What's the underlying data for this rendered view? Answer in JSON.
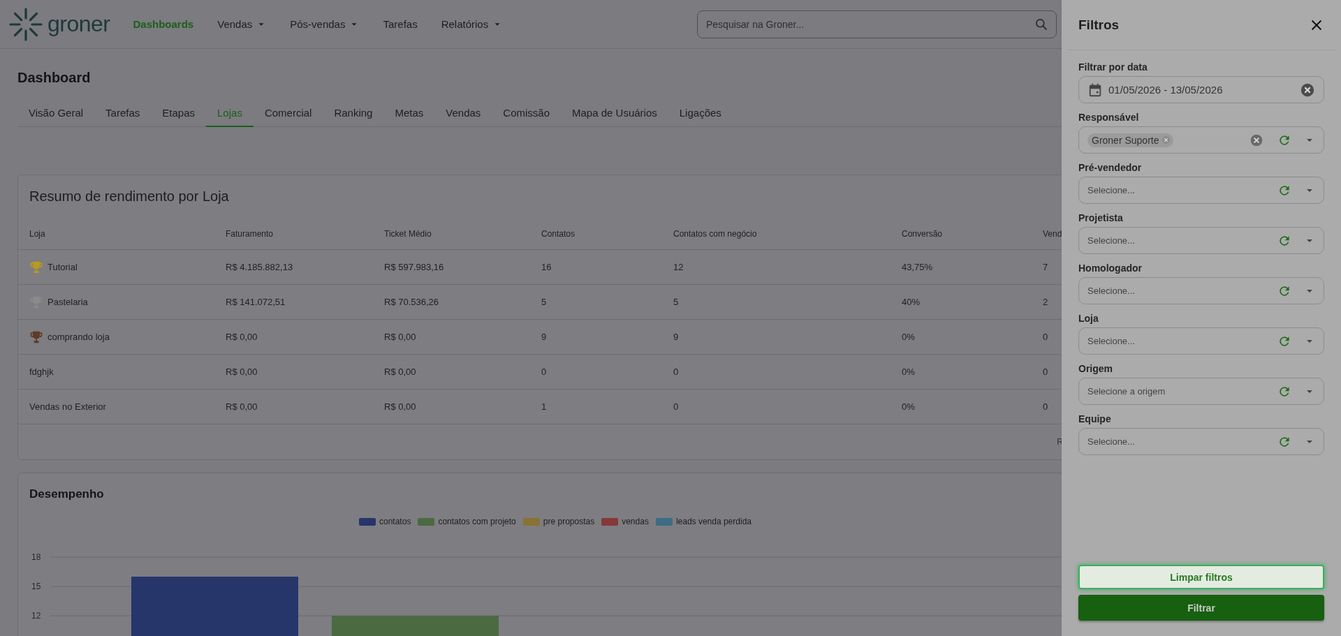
{
  "header": {
    "logo": "groner",
    "nav": [
      {
        "label": "Dashboards",
        "selected": true,
        "dropdown": false
      },
      {
        "label": "Vendas",
        "selected": false,
        "dropdown": true
      },
      {
        "label": "Pós-vendas",
        "selected": false,
        "dropdown": true
      },
      {
        "label": "Tarefas",
        "selected": false,
        "dropdown": false
      },
      {
        "label": "Relatórios",
        "selected": false,
        "dropdown": true
      }
    ],
    "search": {
      "placeholder": "Pesquisar na Groner..."
    }
  },
  "page_title": "Dashboard",
  "tabs": [
    {
      "label": "Visão Geral",
      "selected": false
    },
    {
      "label": "Tarefas",
      "selected": false
    },
    {
      "label": "Etapas",
      "selected": false
    },
    {
      "label": "Lojas",
      "selected": true
    },
    {
      "label": "Comercial",
      "selected": false
    },
    {
      "label": "Ranking",
      "selected": false
    },
    {
      "label": "Metas",
      "selected": false
    },
    {
      "label": "Vendas",
      "selected": false
    },
    {
      "label": "Comissão",
      "selected": false
    },
    {
      "label": "Mapa de Usuários",
      "selected": false
    },
    {
      "label": "Ligações",
      "selected": false
    }
  ],
  "table": {
    "title": "Resumo de rendimento por Loja",
    "columns": [
      "Loja",
      "Faturamento",
      "Ticket Médio",
      "Contatos",
      "Contatos com negócio",
      "Conversão",
      "Vend"
    ],
    "rows": [
      {
        "color": "#b89a1e",
        "cells": [
          "Tutorial",
          "R$ 4.185.882,13",
          "R$ 597.983,16",
          "16",
          "12",
          "43,75%",
          "7"
        ]
      },
      {
        "color": "#8a8a8a",
        "cells": [
          "Pastelaria",
          "R$ 141.072,51",
          "R$ 70.536,26",
          "5",
          "5",
          "40%",
          "2"
        ]
      },
      {
        "color": "#5e3a28",
        "cells": [
          "comprando loja",
          "R$ 0,00",
          "R$ 0,00",
          "9",
          "9",
          "0%",
          "0"
        ]
      },
      {
        "cells": [
          "fdghjk",
          "R$ 0,00",
          "R$ 0,00",
          "0",
          "0",
          "0%",
          "0"
        ]
      },
      {
        "cells": [
          "Vendas no Exterior",
          "R$ 0,00",
          "R$ 0,00",
          "1",
          "0",
          "0%",
          "0"
        ]
      }
    ],
    "footer_text": "R"
  },
  "performance": {
    "title": "Desempenho",
    "chart_data": {
      "type": "bar",
      "ylim": [
        9.5,
        18
      ],
      "grid": true,
      "yticks": [
        12,
        15,
        18
      ],
      "series": [
        {
          "name": "contatos",
          "color": "#27366a",
          "values": [
            16
          ]
        },
        {
          "name": "contatos com projeto",
          "color": "#4b6a41",
          "values": [
            12
          ]
        },
        {
          "name": "pre propostas",
          "color": "#8a7234",
          "values": [
            null
          ]
        },
        {
          "name": "vendas",
          "color": "#873838",
          "values": [
            null
          ]
        },
        {
          "name": "leads venda perdida",
          "color": "#3e6c83",
          "values": [
            null
          ]
        }
      ]
    }
  },
  "filters": {
    "title": "Filtros",
    "fields": [
      {
        "kind": "date",
        "label": "Filtrar por data",
        "value": "01/05/2026 - 13/05/2026"
      },
      {
        "kind": "multi",
        "label": "Responsável",
        "chips": [
          "Groner Suporte"
        ]
      },
      {
        "kind": "select",
        "label": "Pré-vendedor",
        "placeholder": "Selecione..."
      },
      {
        "kind": "select",
        "label": "Projetista",
        "placeholder": "Selecione..."
      },
      {
        "kind": "select",
        "label": "Homologador",
        "placeholder": "Selecione..."
      },
      {
        "kind": "select",
        "label": "Loja",
        "placeholder": "Selecione..."
      },
      {
        "kind": "select",
        "label": "Origem",
        "placeholder": "Selecione a origem"
      },
      {
        "kind": "select",
        "label": "Equipe",
        "placeholder": "Selecione..."
      }
    ],
    "buttons": [
      {
        "kind": "secondary",
        "label": "Limpar filtros"
      },
      {
        "kind": "primary",
        "label": "Filtrar"
      }
    ]
  }
}
